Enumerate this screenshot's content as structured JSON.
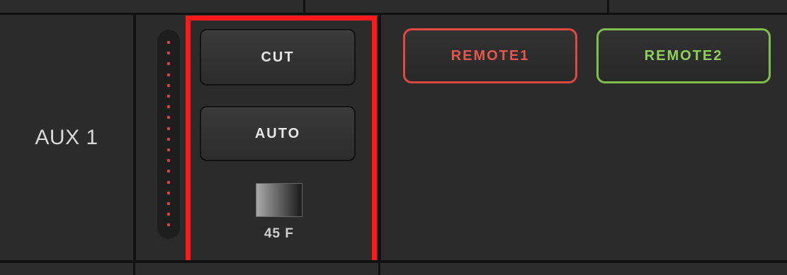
{
  "row": {
    "label": "AUX 1"
  },
  "transition": {
    "cut_label": "CUT",
    "auto_label": "AUTO",
    "duration_text": "45 F"
  },
  "sources": [
    {
      "label": "REMOTE1",
      "state": "program",
      "color": "#e0493e"
    },
    {
      "label": "REMOTE2",
      "state": "preview",
      "color": "#7fc04a"
    }
  ],
  "highlight_color": "#ff1a1a",
  "icons": {
    "meter": "level-meter-icon",
    "fade": "fade-gradient-icon"
  }
}
